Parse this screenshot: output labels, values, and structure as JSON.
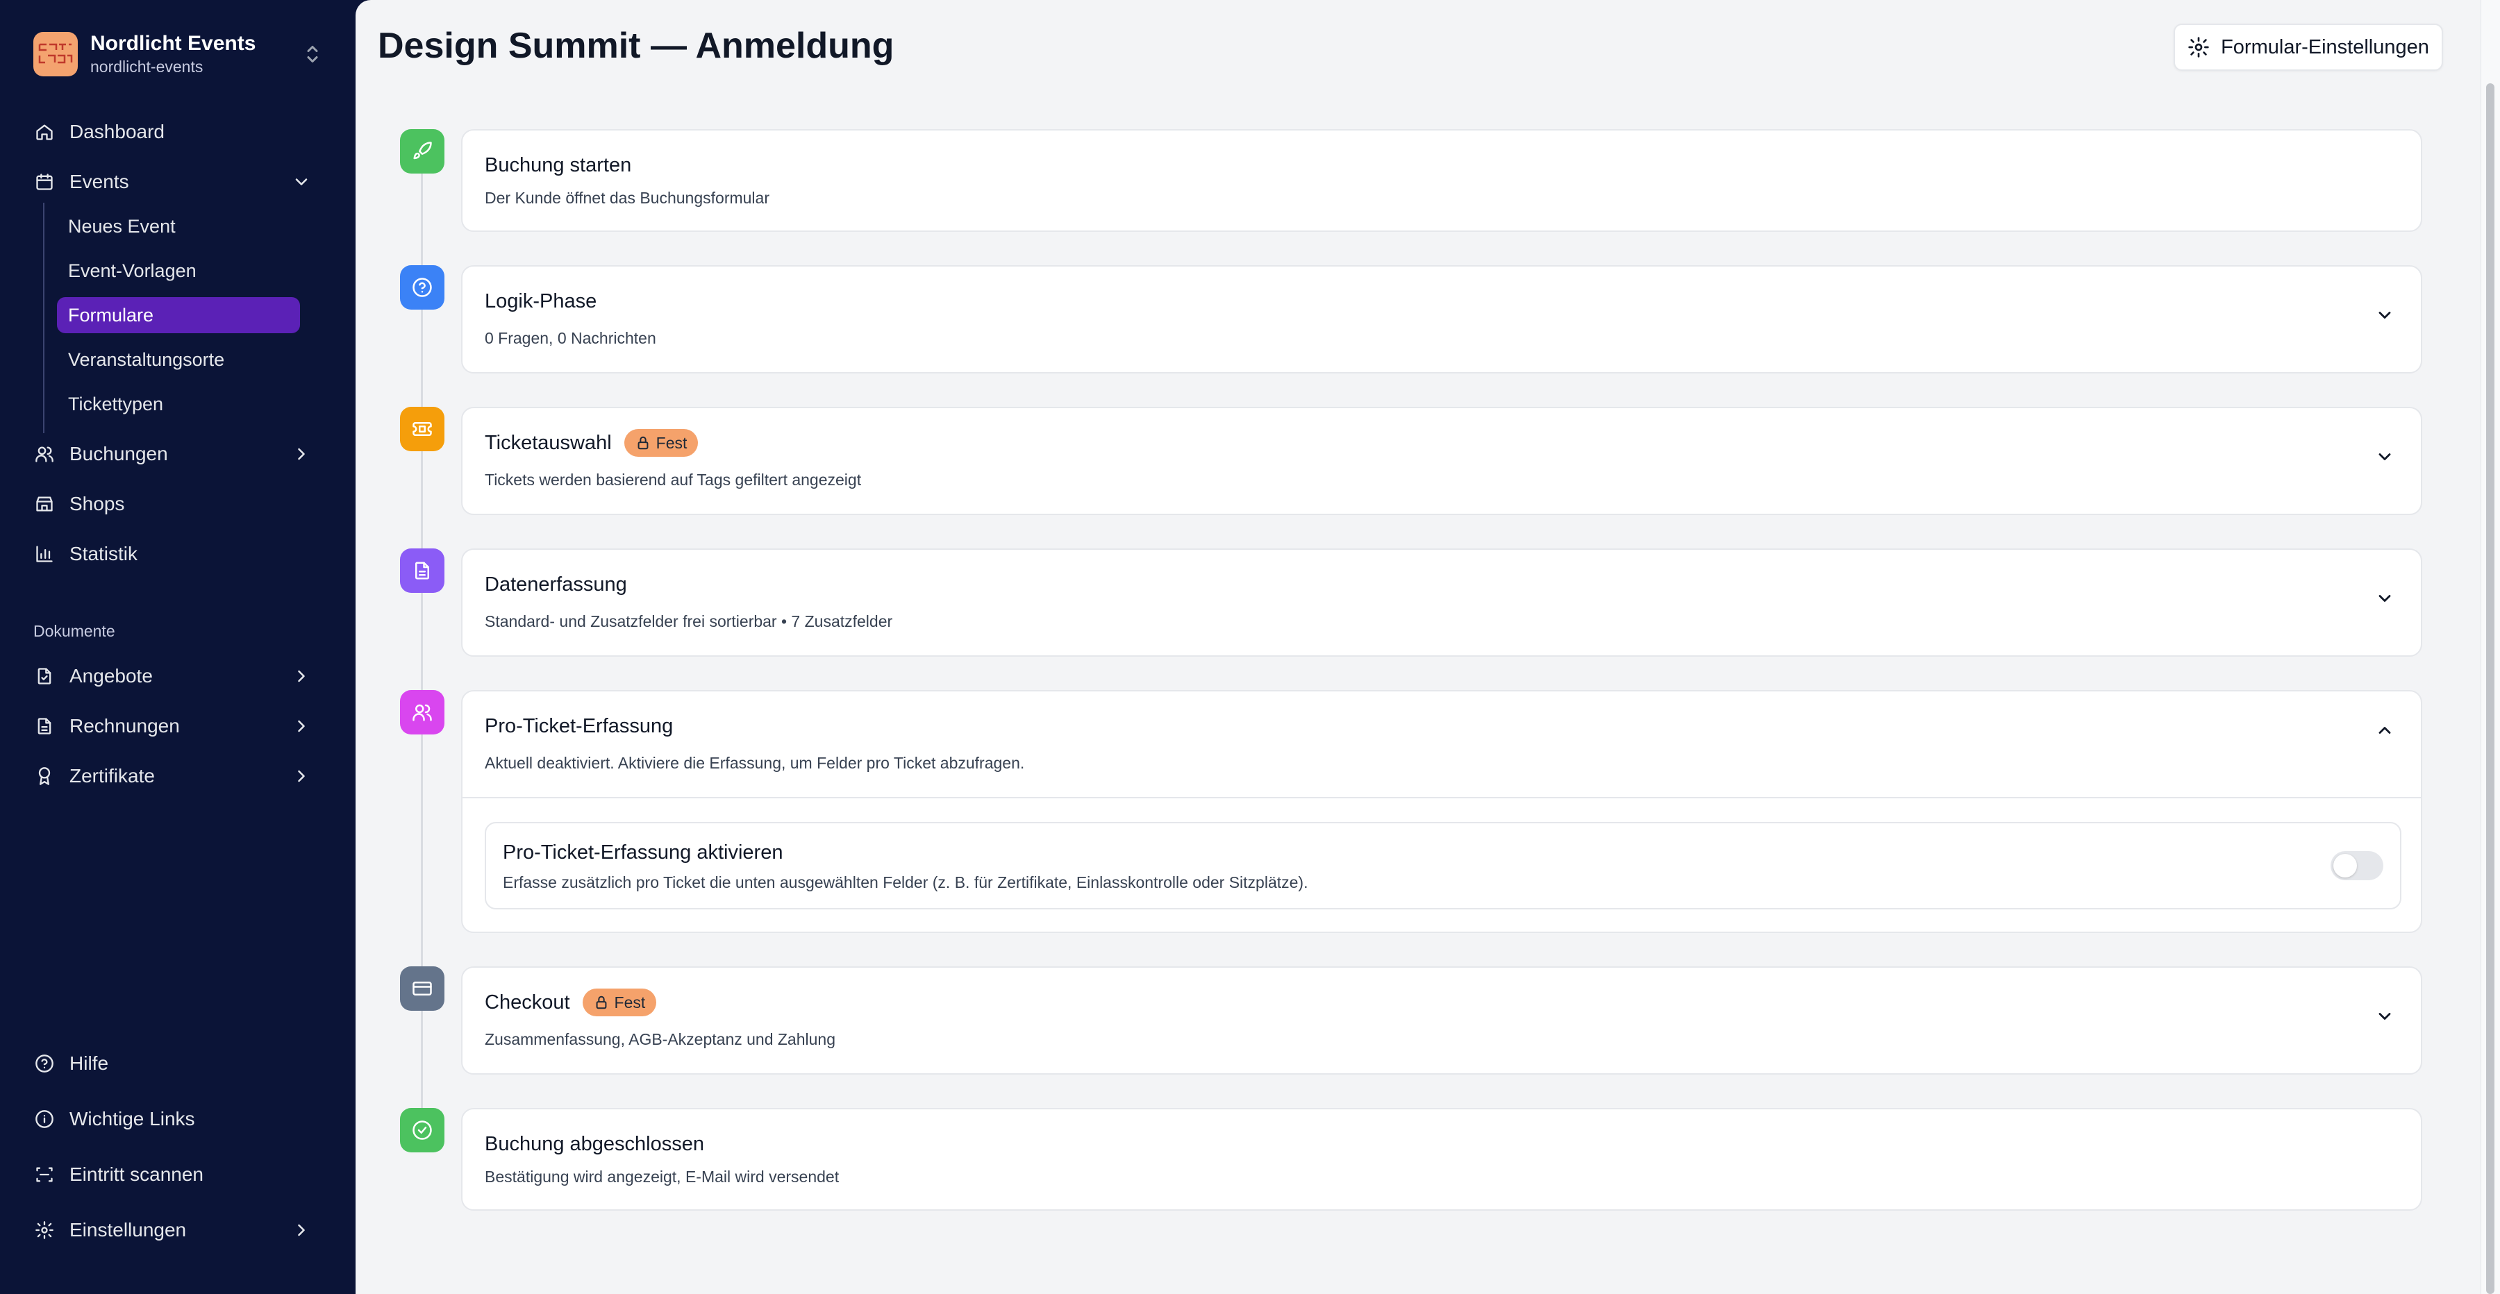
{
  "org": {
    "name": "Nordlicht Events",
    "slug": "nordlicht-events"
  },
  "sidebar": {
    "dashboard": "Dashboard",
    "events": "Events",
    "events_sub": [
      "Neues Event",
      "Event-Vorlagen",
      "Formulare",
      "Veranstaltungsorte",
      "Tickettypen"
    ],
    "buchungen": "Buchungen",
    "shops": "Shops",
    "statistik": "Statistik",
    "section_dokumente": "Dokumente",
    "angebote": "Angebote",
    "rechnungen": "Rechnungen",
    "zertifikate": "Zertifikate",
    "hilfe": "Hilfe",
    "links": "Wichtige Links",
    "scan": "Eintritt scannen",
    "einstellungen": "Einstellungen"
  },
  "header": {
    "title": "Design Summit — Anmeldung",
    "settings_button": "Formular-Einstellungen"
  },
  "steps": [
    {
      "title": "Buchung starten",
      "subtitle": "Der Kunde öffnet das Buchungsformular",
      "color": "#4cc25f",
      "icon": "rocket-icon"
    },
    {
      "title": "Logik-Phase",
      "subtitle": "0 Fragen, 0 Nachrichten",
      "color": "#3b82f6",
      "icon": "question-icon"
    },
    {
      "title": "Ticketauswahl",
      "badge": "Fest",
      "subtitle": "Tickets werden basierend auf Tags gefiltert angezeigt",
      "color": "#f59e0b",
      "icon": "ticket-icon"
    },
    {
      "title": "Datenerfassung",
      "subtitle": "Standard- und Zusatzfelder frei sortierbar • 7 Zusatzfelder",
      "color": "#8b5cf6",
      "icon": "document-icon"
    },
    {
      "title": "Pro-Ticket-Erfassung",
      "subtitle": "Aktuell deaktiviert. Aktiviere die Erfassung, um Felder pro Ticket abzufragen.",
      "color": "#d946ef",
      "icon": "users-icon",
      "toggle_title": "Pro-Ticket-Erfassung aktivieren",
      "toggle_sub": "Erfasse zusätzlich pro Ticket die unten ausgewählten Felder (z. B. für Zertifikate, Einlasskontrolle oder Sitzplätze).",
      "toggle_on": false
    },
    {
      "title": "Checkout",
      "badge": "Fest",
      "subtitle": "Zusammenfassung, AGB-Akzeptanz und Zahlung",
      "color": "#64748b",
      "icon": "card-icon"
    },
    {
      "title": "Buchung abgeschlossen",
      "subtitle": "Bestätigung wird angezeigt, E-Mail wird versendet",
      "color": "#4cc25f",
      "icon": "check-circle-icon"
    }
  ]
}
